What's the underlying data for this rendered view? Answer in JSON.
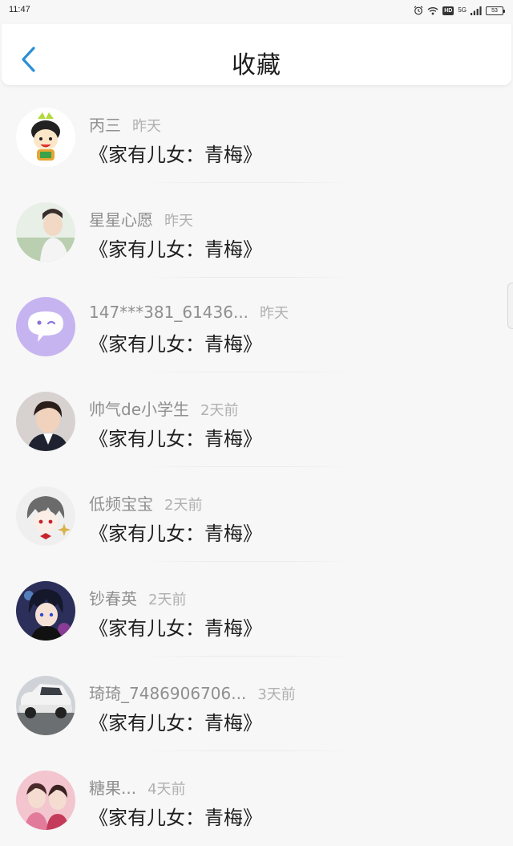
{
  "status_bar": {
    "time": "11:47",
    "hd_label": "HD",
    "network_label": "5G",
    "battery_level": "53"
  },
  "header": {
    "title": "收藏",
    "back_icon": "chevron-left-icon",
    "accent_color": "#2a8fd6"
  },
  "favorites": [
    {
      "name": "丙三",
      "time": "昨天",
      "content": "《家有儿女：青梅》",
      "avatar": "cartoon-avatar"
    },
    {
      "name": "星星心愿",
      "time": "昨天",
      "content": "《家有儿女：青梅》",
      "avatar": "photo-avatar"
    },
    {
      "name": "147***381_61436...",
      "time": "昨天",
      "content": "《家有儿女：青梅》",
      "avatar": "chat-bubble-avatar"
    },
    {
      "name": "帅气de小学生",
      "time": "2天前",
      "content": "《家有儿女：青梅》",
      "avatar": "photo-avatar"
    },
    {
      "name": "低频宝宝",
      "time": "2天前",
      "content": "《家有儿女：青梅》",
      "avatar": "anime-avatar"
    },
    {
      "name": "钞春英",
      "time": "2天前",
      "content": "《家有儿女：青梅》",
      "avatar": "anime-avatar"
    },
    {
      "name": "琦琦_7486906706...",
      "time": "3天前",
      "content": "《家有儿女：青梅》",
      "avatar": "car-photo-avatar"
    },
    {
      "name": "糖果...",
      "time": "4天前",
      "content": "《家有儿女：青梅》",
      "avatar": "photo-avatar"
    }
  ]
}
